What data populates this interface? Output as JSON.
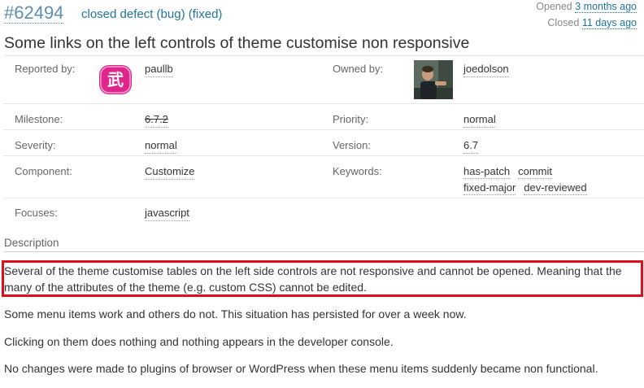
{
  "header": {
    "ticket_id": "#62494",
    "status": "closed",
    "type": "defect (bug)",
    "resolution": "(fixed)",
    "opened_prefix": "Opened",
    "opened_ago": "3 months ago",
    "closed_prefix": "Closed",
    "closed_ago": "11 days ago"
  },
  "summary": "Some links on the left controls of theme customise non responsive",
  "properties": {
    "reported_by_label": "Reported by:",
    "reporter": "paullb",
    "owned_by_label": "Owned by:",
    "owner": "joedolson",
    "milestone_label": "Milestone:",
    "milestone": "6.7.2",
    "priority_label": "Priority:",
    "priority": "normal",
    "severity_label": "Severity:",
    "severity": "normal",
    "version_label": "Version:",
    "version": "6.7",
    "component_label": "Component:",
    "component": "Customize",
    "keywords_label": "Keywords:",
    "keywords": [
      "has-patch",
      "commit",
      "fixed-major",
      "dev-reviewed"
    ],
    "focuses_label": "Focuses:",
    "focuses": "javascript",
    "reporter_avatar_glyph": "武"
  },
  "description": {
    "heading": "Description",
    "paragraphs": [
      "Several of the theme customise tables on the left side controls are not responsive and cannot be opened. Meaning that the many of the attributes of the theme (e.g. custom CSS) cannot be edited.",
      "Some menu items work and others do not. This situation has persisted for over a week now.",
      "Clicking on them does nothing and nothing appears in the developer console.",
      "No changes were made to plugins of browser or WordPress when these menu items suddenly became non functional."
    ]
  },
  "colors": {
    "link": "#21759b",
    "highlight_border": "#e00d1b",
    "reporter_avatar": "#e0268c"
  }
}
